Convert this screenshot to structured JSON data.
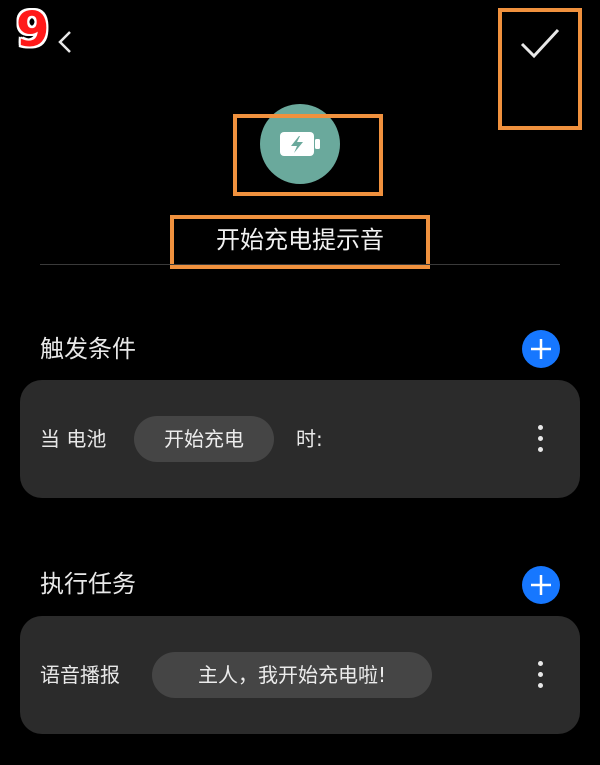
{
  "step_badge": "9",
  "header": {
    "back_icon": "chevron-left-icon",
    "confirm_icon": "checkmark-icon"
  },
  "scene": {
    "icon": "charging-battery-icon",
    "icon_color": "#6aa99c",
    "title": "开始充电提示音"
  },
  "trigger_section": {
    "title": "触发条件",
    "add_icon": "plus-icon",
    "condition": {
      "prefix": "当 电池",
      "value": "开始充电",
      "suffix": "时:"
    }
  },
  "task_section": {
    "title": "执行任务",
    "add_icon": "plus-icon",
    "task": {
      "label": "语音播报",
      "value": "主人，我开始充电啦!"
    }
  },
  "colors": {
    "accent": "#1677ff",
    "highlight": "#f0913e",
    "background": "#000000",
    "card": "#2b2b2b"
  }
}
